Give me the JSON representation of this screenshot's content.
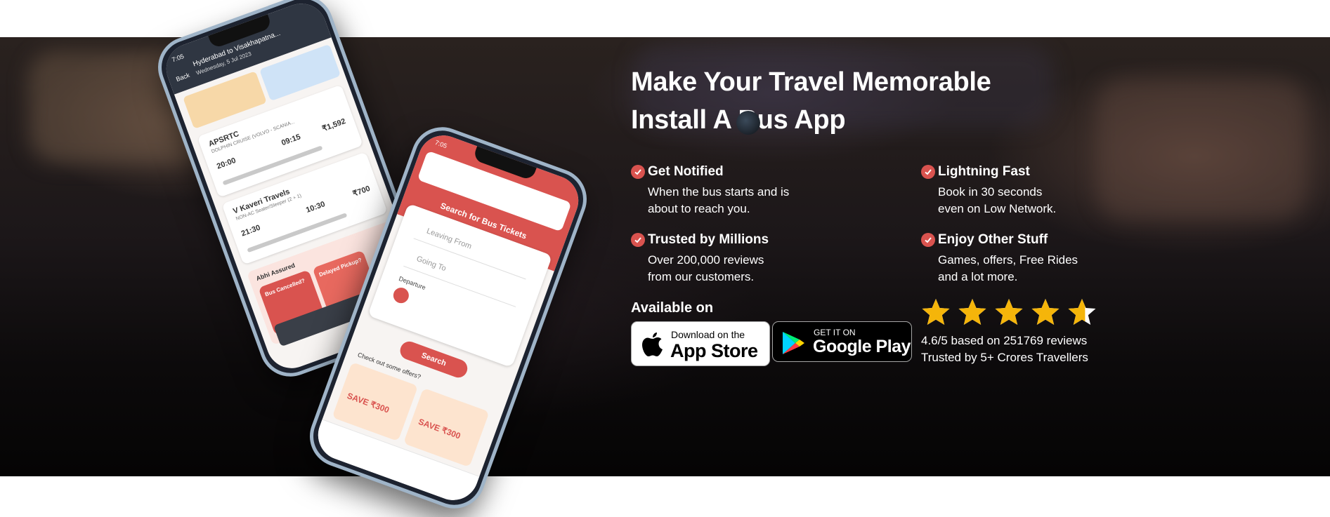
{
  "headline": {
    "line1": "Make Your Travel Memorable",
    "line2": "Install A   Bus App"
  },
  "features": [
    {
      "title": "Get Notified",
      "desc1": "When the bus starts and is",
      "desc2": "about to reach you."
    },
    {
      "title": "Lightning Fast",
      "desc1": "Book in 30 seconds",
      "desc2": "even on Low Network."
    },
    {
      "title": "Trusted by Millions",
      "desc1": "Over 200,000 reviews",
      "desc2": "from our customers."
    },
    {
      "title": "Enjoy Other Stuff",
      "desc1": "Games, offers, Free Rides",
      "desc2": "and a lot more."
    }
  ],
  "available_on": "Available on",
  "app_store": {
    "small": "Download on the",
    "big": "App Store"
  },
  "google_play": {
    "small": "GET IT ON",
    "big": "Google Play"
  },
  "rating": {
    "stars": 4.6,
    "text": "4.6/5 based on 251769 reviews",
    "trusted": "Trusted by 5+ Crores Travellers"
  },
  "phone_list": {
    "time": "7:05",
    "route": "Hyderabad to Visakhapatna...",
    "date": "Wednesday, 5 Jul 2023",
    "back": "Back",
    "op1": "APSRTC",
    "op1_type": "DOLPHIN CRUISE (VOLVO - SCANIA...",
    "op1_dep": "20:00",
    "op1_arr": "09:15",
    "op1_price": "₹1,592",
    "op2": "V Kaveri Travels",
    "op2_type": "NON-AC Seater/Sleeper (2 + 1)",
    "op2_dep": "21:30",
    "op2_arr": "10:30",
    "op2_price": "₹700",
    "assured": "Abhi Assured",
    "tile1": "Bus Cancelled?",
    "tile2": "Delayed Pickup?"
  },
  "phone_search": {
    "time": "7:05",
    "heading": "Search for Bus Tickets",
    "from": "Leaving From",
    "to": "Going To",
    "departure": "Departure",
    "search": "Search",
    "offers": "Check out some offers?",
    "offer1": "SAVE ₹300",
    "offer2": "SAVE ₹300"
  },
  "colors": {
    "accent": "#d9534f",
    "star": "#f5b50a"
  }
}
